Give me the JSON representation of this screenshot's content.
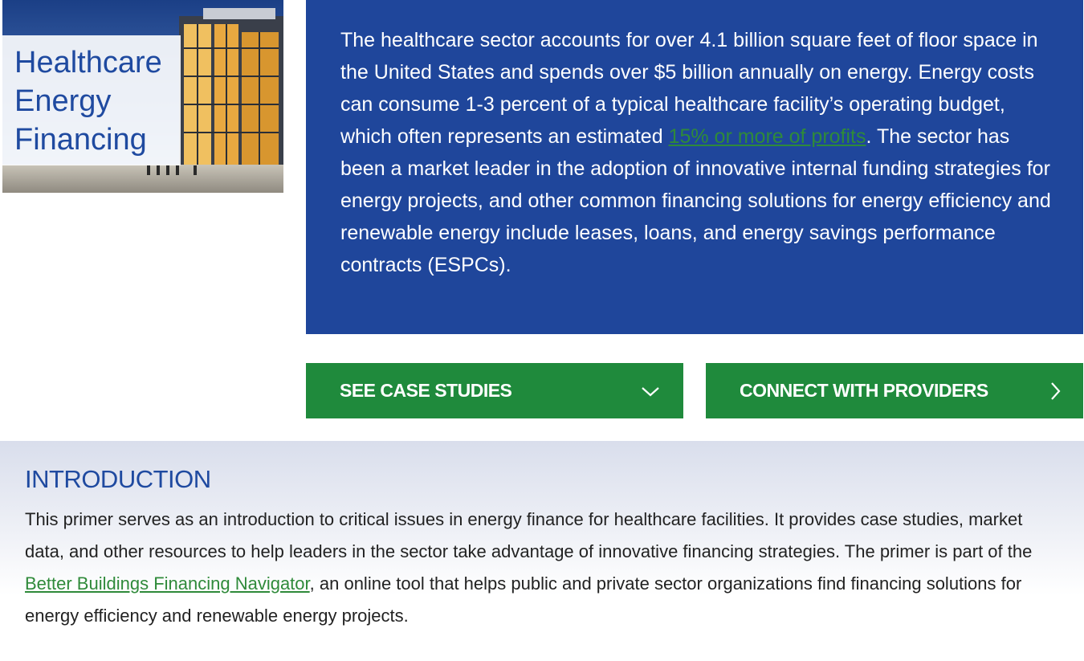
{
  "hero": {
    "title_lines": [
      "Healthcare",
      "Energy",
      "Financing"
    ]
  },
  "summary": {
    "text_before_link": "The healthcare sector accounts for over 4.1 billion square feet of floor space in the United States and spends over $5 billion annually on energy. Energy costs can consume 1-3 percent of a typical healthcare facility’s operating budget, which often represents an estimated ",
    "link_text": "15% or more of profits",
    "text_after_link": ". The sector has been a market leader in the adoption of innovative internal funding strategies for energy projects, and other common financing solutions for energy efficiency and renewable energy include leases, loans, and energy savings performance contracts (ESPCs)."
  },
  "buttons": {
    "case_studies": {
      "label": "SEE CASE STUDIES",
      "icon": "chevron-down-icon"
    },
    "connect": {
      "label": "CONNECT WITH PROVIDERS",
      "icon": "chevron-right-icon"
    }
  },
  "intro": {
    "heading": "INTRODUCTION",
    "text_before_link": "This primer serves as an introduction to critical issues in energy finance for healthcare facilities. It provides case studies, market data, and other resources to help leaders in the sector take advantage of innovative financing strategies. The primer is part of the ",
    "link_text": "Better Buildings Financing Navigator",
    "text_after_link": ", an online tool that helps public and private sector organizations find financing solutions for energy efficiency and renewable energy projects."
  },
  "colors": {
    "brand_blue": "#1f469b",
    "action_green": "#1f8a3c",
    "link_green": "#2f8a3a",
    "heading_blue": "#1f4aa0"
  }
}
